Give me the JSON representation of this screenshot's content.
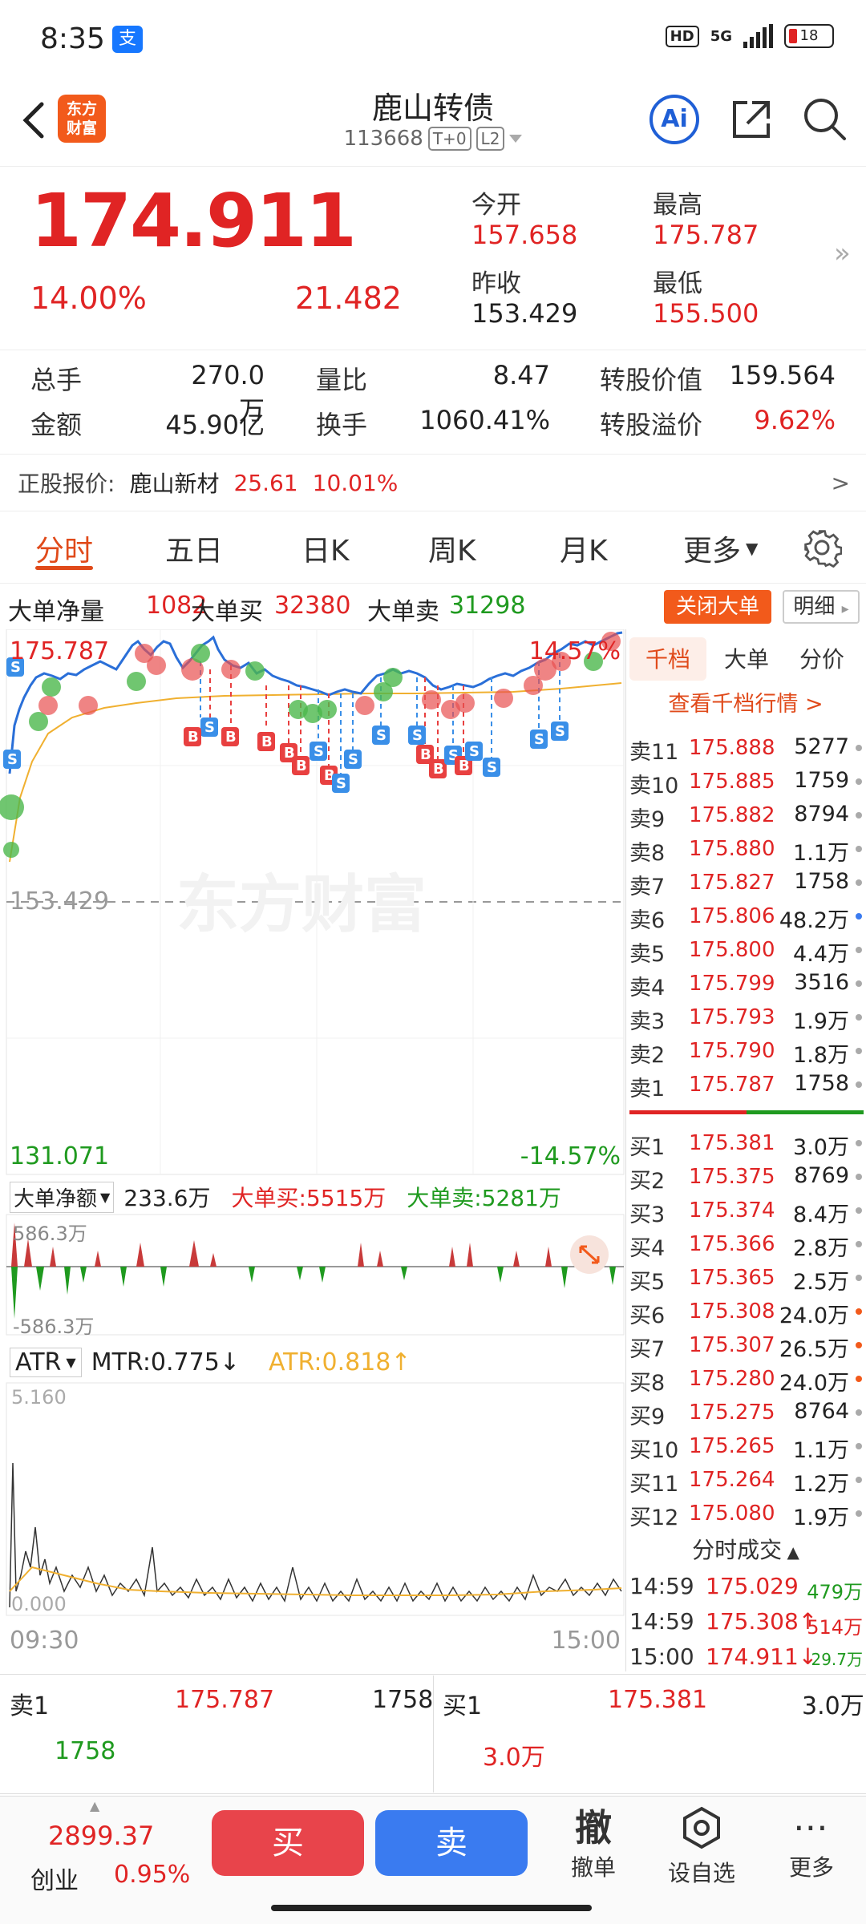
{
  "status": {
    "time": "8:35",
    "alipay": "支",
    "hd": "HD",
    "net": "5G",
    "battery": "18"
  },
  "header": {
    "logo_line1": "东方",
    "logo_line2": "财富",
    "title": "鹿山转债",
    "code": "113668",
    "tag1": "T+0",
    "tag2": "L2",
    "ai_label": "Ai"
  },
  "quote": {
    "price": "174.911",
    "change_pct": "14.00%",
    "change": "21.482",
    "open_label": "今开",
    "open": "157.658",
    "high_label": "最高",
    "high": "175.787",
    "prev_label": "昨收",
    "prev": "153.429",
    "low_label": "最低",
    "low": "155.500",
    "more": "»"
  },
  "stats": {
    "r1": [
      {
        "label": "总手",
        "value": "270.0万"
      },
      {
        "label": "量比",
        "value": "8.47"
      },
      {
        "label": "转股价值",
        "value": "159.564"
      }
    ],
    "r2": [
      {
        "label": "金额",
        "value": "45.90亿"
      },
      {
        "label": "换手",
        "value": "1060.41%"
      },
      {
        "label": "转股溢价",
        "value": "9.62%"
      }
    ]
  },
  "underlying": {
    "label": "正股报价:",
    "name": "鹿山新材",
    "price": "25.61",
    "pct": "10.01%",
    "arrow": ">"
  },
  "tabs": [
    "分时",
    "五日",
    "日K",
    "周K",
    "月K",
    "更多"
  ],
  "big_orders": {
    "net_label": "大单净量",
    "net": "1082",
    "buy_label": "大单买",
    "buy": "32380",
    "sell_label": "大单卖",
    "sell": "31298",
    "close_btn": "关闭大单",
    "detail_btn": "明细"
  },
  "chart": {
    "top_price": "175.787",
    "top_pct": "14.57%",
    "mid_price": "153.429",
    "bottom_price": "131.071",
    "bottom_pct": "-14.57%",
    "watermark": "东方财富",
    "flow_selector": "大单净额",
    "flow_value": "233.6万",
    "flow_buy": "大单买:5515万",
    "flow_sell": "大单卖:5281万",
    "flow_top": "586.3万",
    "flow_bottom": "-586.3万",
    "atr_selector": "ATR",
    "mtr": "MTR:0.775",
    "atr": "ATR:0.818",
    "atr_top": "5.160",
    "atr_bottom": "0.000",
    "time_start": "09:30",
    "time_end": "15:00"
  },
  "orderbook": {
    "tabs": [
      "千档",
      "大单",
      "分价"
    ],
    "link": "查看千档行情 >",
    "asks": [
      {
        "label": "卖11",
        "price": "175.888",
        "vol": "5277"
      },
      {
        "label": "卖10",
        "price": "175.885",
        "vol": "1759"
      },
      {
        "label": "卖9",
        "price": "175.882",
        "vol": "8794"
      },
      {
        "label": "卖8",
        "price": "175.880",
        "vol": "1.1万"
      },
      {
        "label": "卖7",
        "price": "175.827",
        "vol": "1758"
      },
      {
        "label": "卖6",
        "price": "175.806",
        "vol": "48.2万"
      },
      {
        "label": "卖5",
        "price": "175.800",
        "vol": "4.4万"
      },
      {
        "label": "卖4",
        "price": "175.799",
        "vol": "3516"
      },
      {
        "label": "卖3",
        "price": "175.793",
        "vol": "1.9万"
      },
      {
        "label": "卖2",
        "price": "175.790",
        "vol": "1.8万"
      },
      {
        "label": "卖1",
        "price": "175.787",
        "vol": "1758"
      }
    ],
    "bids": [
      {
        "label": "买1",
        "price": "175.381",
        "vol": "3.0万"
      },
      {
        "label": "买2",
        "price": "175.375",
        "vol": "8769"
      },
      {
        "label": "买3",
        "price": "175.374",
        "vol": "8.4万"
      },
      {
        "label": "买4",
        "price": "175.366",
        "vol": "2.8万"
      },
      {
        "label": "买5",
        "price": "175.365",
        "vol": "2.5万"
      },
      {
        "label": "买6",
        "price": "175.308",
        "vol": "24.0万"
      },
      {
        "label": "买7",
        "price": "175.307",
        "vol": "26.5万"
      },
      {
        "label": "买8",
        "price": "175.280",
        "vol": "24.0万"
      },
      {
        "label": "买9",
        "price": "175.275",
        "vol": "8764"
      },
      {
        "label": "买10",
        "price": "175.265",
        "vol": "1.1万"
      },
      {
        "label": "买11",
        "price": "175.264",
        "vol": "1.2万"
      },
      {
        "label": "买12",
        "price": "175.080",
        "vol": "1.9万"
      }
    ],
    "trades_title": "分时成交",
    "trades": [
      {
        "time": "14:59",
        "price": "175.029",
        "vol": "479万"
      },
      {
        "time": "14:59",
        "price": "175.308↑",
        "vol": "514万"
      },
      {
        "time": "15:00",
        "price": "174.911↓",
        "vol": "29.7万"
      }
    ]
  },
  "quick": {
    "left_label": "卖1",
    "left_price": "175.787",
    "left_vol": "1758",
    "left_sub": "1758",
    "right_label": "买1",
    "right_price": "175.381",
    "right_vol": "3.0万",
    "right_sub": "3.0万"
  },
  "bottom": {
    "index_value": "2899.37",
    "index_name": "创业",
    "index_pct": "0.95%",
    "buy": "买",
    "sell": "卖",
    "cancel_icon": "撤",
    "cancel": "撤单",
    "watch": "设自选",
    "more": "更多"
  },
  "colors": {
    "up": "#e02424",
    "down": "#1f9a1f",
    "accent": "#f25a1b",
    "avg_line": "#f0b030",
    "price_line": "#2a6fd8"
  }
}
